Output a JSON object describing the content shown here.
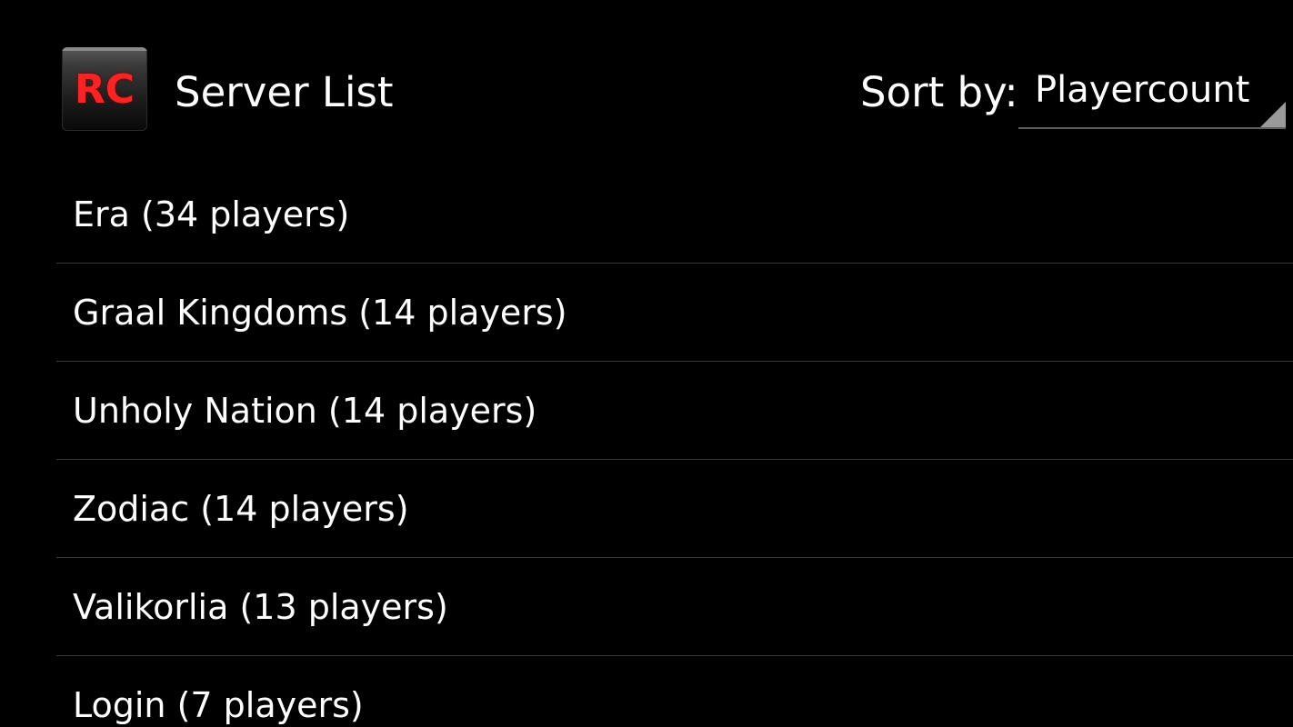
{
  "app": {
    "icon_text": "RC",
    "icon_name": "rc-app-icon",
    "icon_color": "#ff2222"
  },
  "header": {
    "title": "Server List",
    "sort_label": "Sort by:",
    "sort_value": "Playercount",
    "sort_icon": "dropdown-corner-icon"
  },
  "servers": [
    {
      "label": "Era (34 players)"
    },
    {
      "label": "Graal Kingdoms (14 players)"
    },
    {
      "label": "Unholy Nation (14 players)"
    },
    {
      "label": "Zodiac (14 players)"
    },
    {
      "label": "Valikorlia (13 players)"
    },
    {
      "label": "Login (7 players)"
    }
  ],
  "colors": {
    "background": "#000000",
    "text": "#ffffff",
    "divider": "#3a3a3a"
  }
}
